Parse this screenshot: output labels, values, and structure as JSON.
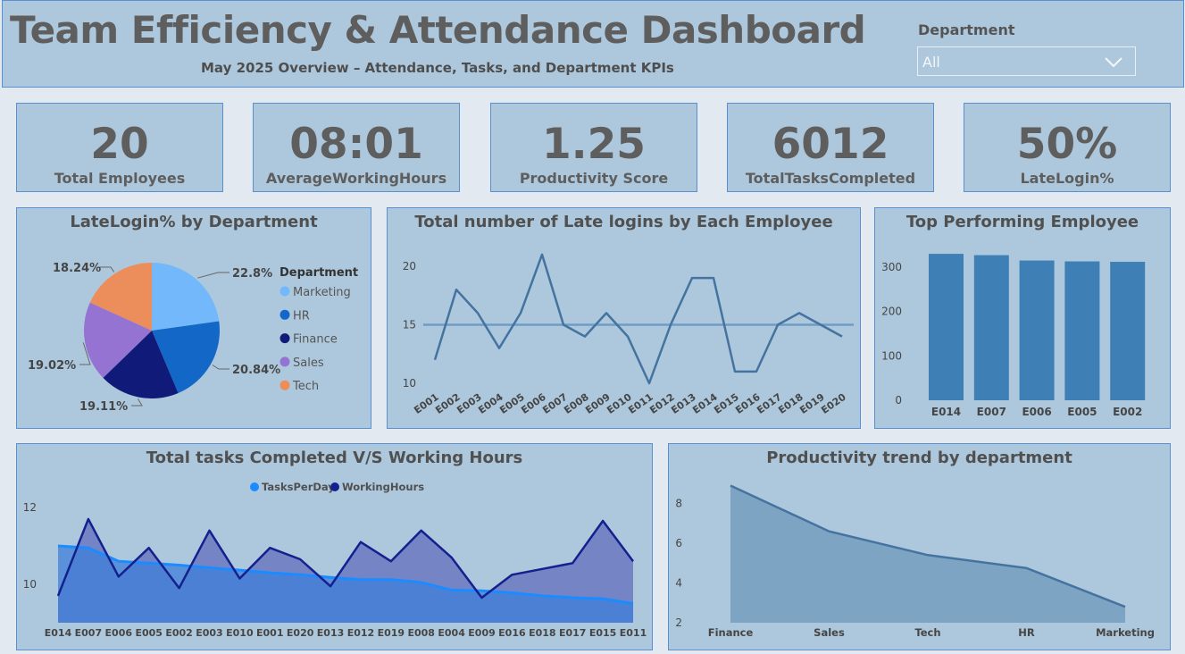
{
  "header": {
    "title": "Team Efficiency & Attendance Dashboard",
    "subtitle": "May 2025 Overview – Attendance, Tasks, and Department KPIs"
  },
  "filter": {
    "label": "Department",
    "value": "All"
  },
  "kpis": [
    {
      "value": "20",
      "label": "Total Employees"
    },
    {
      "value": "08:01",
      "label": "AverageWorkingHours"
    },
    {
      "value": "1.25",
      "label": "Productivity Score"
    },
    {
      "value": "6012",
      "label": "TotalTasksCompleted"
    },
    {
      "value": "50%",
      "label": "LateLogin%"
    }
  ],
  "colors": {
    "background": "#e3e9f1",
    "panel": "#adc8dc",
    "panel_border": "#5a8fd0",
    "line": "#4573a0",
    "bar": "#3e80b5",
    "area": "#7ea4c3"
  },
  "chart_data": [
    {
      "type": "pie",
      "title": "LateLogin% by Department",
      "legend_title": "Department",
      "legend_position": "right",
      "slices": [
        {
          "label": "Marketing",
          "value": 22.8,
          "display": "22.8%",
          "color": "#74b8fc"
        },
        {
          "label": "HR",
          "value": 20.84,
          "display": "20.84%",
          "color": "#1368c7"
        },
        {
          "label": "Finance",
          "value": 19.11,
          "display": "19.11%",
          "color": "#101a78"
        },
        {
          "label": "Sales",
          "value": 19.02,
          "display": "19.02%",
          "color": "#9473d3"
        },
        {
          "label": "Tech",
          "value": 18.24,
          "display": "18.24%",
          "color": "#ec8d5c"
        }
      ]
    },
    {
      "type": "line",
      "title": "Total number of Late logins by Each Employee",
      "x": [
        "E001",
        "E002",
        "E003",
        "E004",
        "E005",
        "E006",
        "E007",
        "E008",
        "E009",
        "E010",
        "E011",
        "E012",
        "E013",
        "E014",
        "E015",
        "E016",
        "E017",
        "E018",
        "E019",
        "E020"
      ],
      "values": [
        12,
        18,
        16,
        13,
        16,
        21,
        15,
        14,
        16,
        14,
        10,
        15,
        19,
        19,
        11,
        11,
        15,
        16,
        15,
        14
      ],
      "average": 15,
      "ylim": [
        10,
        22
      ],
      "yticks": [
        10,
        15,
        20
      ],
      "grid": false
    },
    {
      "type": "bar",
      "title": "Top Performing Employee",
      "categories": [
        "E014",
        "E007",
        "E006",
        "E005",
        "E002"
      ],
      "values": [
        330,
        327,
        315,
        313,
        312
      ],
      "ylim": [
        0,
        340
      ],
      "yticks": [
        0,
        100,
        200,
        300
      ]
    },
    {
      "type": "area",
      "title": "Total tasks Completed V/S Working Hours",
      "legend_position": "top",
      "x": [
        "E014",
        "E007",
        "E006",
        "E005",
        "E002",
        "E003",
        "E010",
        "E001",
        "E020",
        "E013",
        "E012",
        "E019",
        "E008",
        "E004",
        "E009",
        "E016",
        "E018",
        "E017",
        "E015",
        "E011"
      ],
      "series": [
        {
          "name": "TasksPerDay",
          "color": "#1a8cff",
          "values": [
            11.0,
            10.95,
            10.6,
            10.55,
            10.5,
            10.43,
            10.37,
            10.3,
            10.25,
            10.18,
            10.12,
            10.12,
            10.05,
            9.85,
            9.83,
            9.78,
            9.7,
            9.65,
            9.62,
            9.5
          ]
        },
        {
          "name": "WorkingHours",
          "color": "#15208f",
          "values": [
            9.7,
            11.7,
            10.2,
            10.95,
            9.9,
            11.4,
            10.15,
            10.95,
            10.65,
            9.95,
            11.1,
            10.6,
            11.4,
            10.7,
            9.65,
            10.25,
            10.4,
            10.55,
            11.65,
            10.6
          ]
        }
      ],
      "ylim": [
        9.4,
        12.6
      ],
      "yticks": [
        10,
        12
      ]
    },
    {
      "type": "area",
      "title": "Productivity trend by department",
      "categories": [
        "Finance",
        "Sales",
        "Tech",
        "HR",
        "Marketing"
      ],
      "values": [
        8.9,
        6.6,
        5.4,
        4.75,
        2.8
      ],
      "ylim": [
        2,
        9.2
      ],
      "yticks": [
        2,
        4,
        6,
        8
      ]
    }
  ]
}
